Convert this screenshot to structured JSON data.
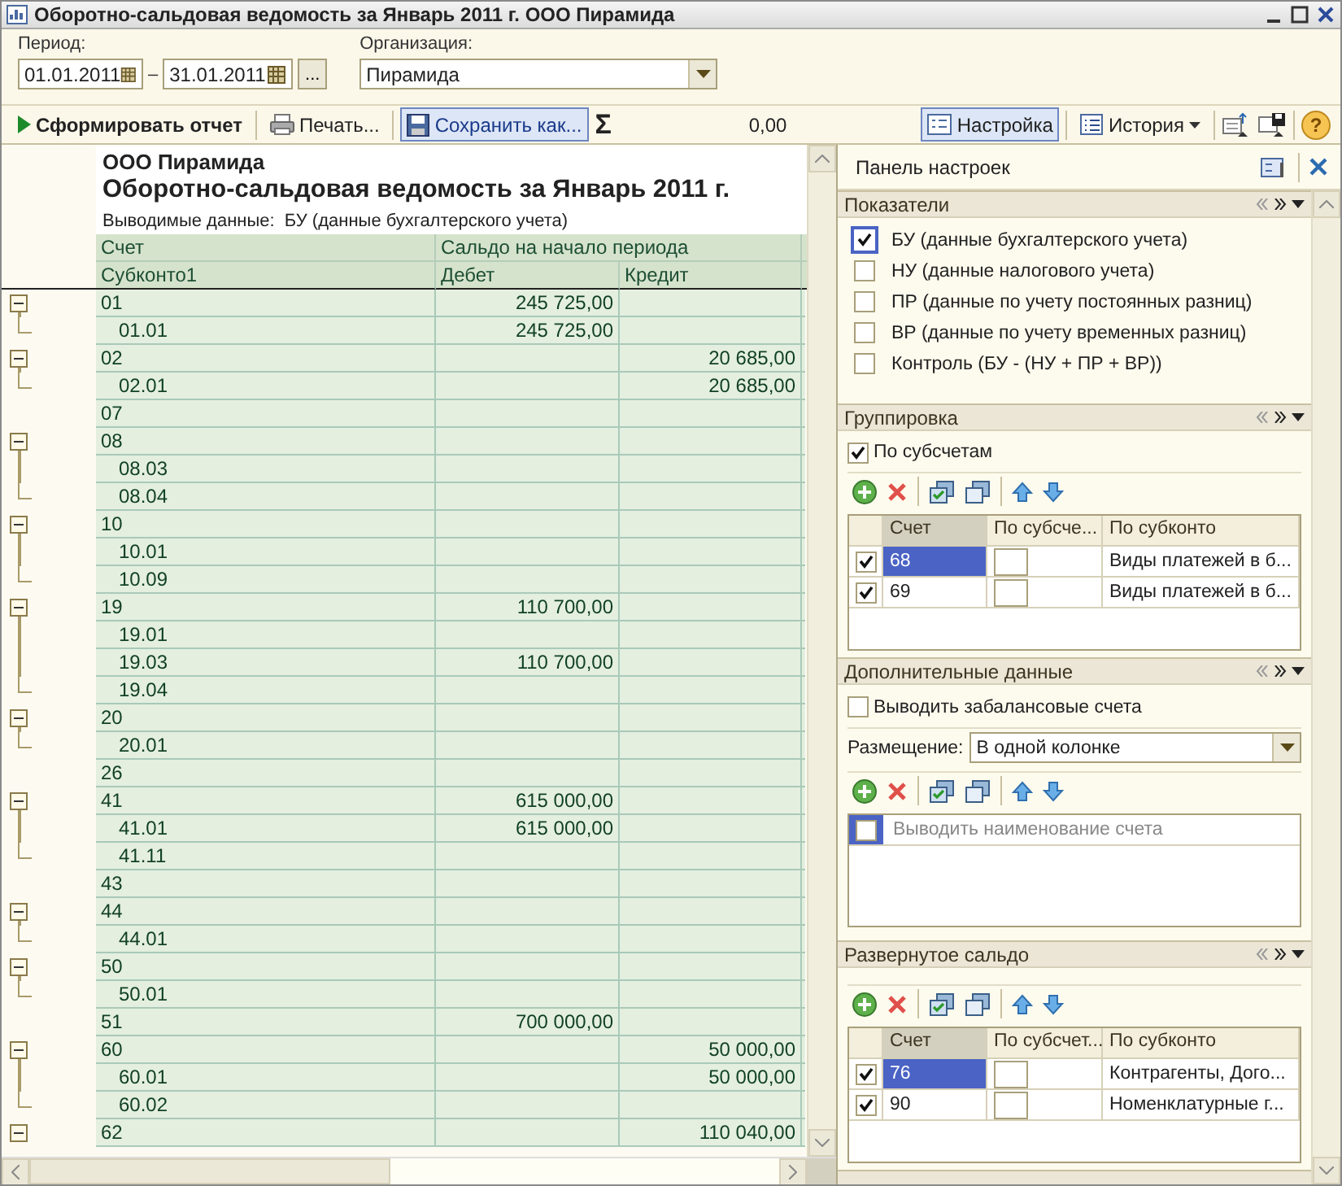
{
  "window": {
    "title": "Оборотно-сальдовая ведомость за Январь 2011 г. ООО Пирамида"
  },
  "form": {
    "period_label": "Период:",
    "date_from": "01.01.2011",
    "dash": "–",
    "date_to": "31.01.2011",
    "period_button": "...",
    "organization_label": "Организация:",
    "organization": "Пирамида"
  },
  "toolbar": {
    "generate": "Сформировать отчет",
    "print": "Печать...",
    "save": {
      "label": "Сохранить как...",
      "selected": true
    },
    "sigma": "Σ",
    "sum": "0,00",
    "settings": {
      "label": "Настройка",
      "selected": true
    },
    "history": "История",
    "help": "?"
  },
  "report": {
    "company": "ООО Пирамида",
    "title": "Оборотно-сальдовая ведомость за Январь 2011 г.",
    "output_label": "Выводимые данные:",
    "output_value": "БУ (данные бухгалтерского учета)",
    "header": {
      "account": "Счет",
      "subconto": "Субконто1",
      "balance": "Сальдо на начало периода",
      "debit": "Дебет",
      "credit": "Кредит"
    },
    "rows": [
      {
        "account": "01",
        "debit": "245 725,00",
        "expanded": true,
        "children": [
          {
            "account": "01.01",
            "debit": "245 725,00"
          }
        ]
      },
      {
        "account": "02",
        "credit": "20 685,00",
        "expanded": true,
        "children": [
          {
            "account": "02.01",
            "credit": "20 685,00"
          }
        ]
      },
      {
        "account": "07"
      },
      {
        "account": "08",
        "expanded": true,
        "children": [
          {
            "account": "08.03"
          },
          {
            "account": "08.04"
          }
        ]
      },
      {
        "account": "10",
        "expanded": true,
        "children": [
          {
            "account": "10.01"
          },
          {
            "account": "10.09"
          }
        ]
      },
      {
        "account": "19",
        "debit": "110 700,00",
        "expanded": true,
        "children": [
          {
            "account": "19.01"
          },
          {
            "account": "19.03",
            "debit": "110 700,00"
          },
          {
            "account": "19.04"
          }
        ]
      },
      {
        "account": "20",
        "expanded": true,
        "children": [
          {
            "account": "20.01"
          }
        ]
      },
      {
        "account": "26"
      },
      {
        "account": "41",
        "debit": "615 000,00",
        "expanded": true,
        "children": [
          {
            "account": "41.01",
            "debit": "615 000,00"
          },
          {
            "account": "41.11"
          }
        ]
      },
      {
        "account": "43"
      },
      {
        "account": "44",
        "expanded": true,
        "children": [
          {
            "account": "44.01"
          }
        ]
      },
      {
        "account": "50",
        "expanded": true,
        "children": [
          {
            "account": "50.01"
          }
        ]
      },
      {
        "account": "51",
        "debit": "700 000,00"
      },
      {
        "account": "60",
        "credit": "50 000,00",
        "expanded": true,
        "children": [
          {
            "account": "60.01",
            "credit": "50 000,00"
          },
          {
            "account": "60.02"
          }
        ]
      },
      {
        "account": "62",
        "credit": "110 040,00",
        "expanded": true
      }
    ]
  },
  "settings_panel": {
    "title": "Панель настроек",
    "indicators": {
      "title": "Показатели",
      "items": [
        {
          "label": "БУ (данные бухгалтерского учета)",
          "checked": true,
          "selected": true
        },
        {
          "label": "НУ (данные налогового учета)",
          "checked": false,
          "selected": false
        },
        {
          "label": "ПР (данные по учету постоянных разниц)",
          "checked": false,
          "selected": false
        },
        {
          "label": "ВР (данные по учету временных разниц)",
          "checked": false,
          "selected": false
        },
        {
          "label": "Контроль (БУ - (НУ + ПР + ВР))",
          "checked": false,
          "selected": false
        }
      ]
    },
    "grouping": {
      "title": "Группировка",
      "option": {
        "label": "По субсчетам",
        "checked": true
      },
      "columns": [
        {
          "label": "Счет",
          "selected": true
        },
        {
          "label": "По субсче...",
          "selected": false
        },
        {
          "label": "По субконто",
          "selected": false
        }
      ],
      "rows": [
        {
          "checked": true,
          "account": "68",
          "by_subaccounts": false,
          "by_subconto": "Виды платежей в б...",
          "selected": true
        },
        {
          "checked": true,
          "account": "69",
          "by_subaccounts": false,
          "by_subconto": "Виды платежей в б...",
          "selected": false
        }
      ]
    },
    "additional": {
      "title": "Дополнительные данные",
      "option": {
        "label": "Выводить забалансовые счета",
        "checked": false
      },
      "placement_label": "Размещение:",
      "placement": "В одной колонке",
      "items": [
        {
          "label": "Выводить наименование счета",
          "checked": false,
          "selected": true,
          "disabled": true
        }
      ]
    },
    "expanded_balance": {
      "title": "Развернутое сальдо",
      "columns": [
        {
          "label": "Счет",
          "selected": true
        },
        {
          "label": "По субсчет...",
          "selected": false
        },
        {
          "label": "По субконто",
          "selected": false
        }
      ],
      "rows": [
        {
          "checked": true,
          "account": "76",
          "by_subaccounts": false,
          "by_subconto": "Контрагенты, Дого...",
          "selected": true
        },
        {
          "checked": true,
          "account": "90",
          "by_subaccounts": false,
          "by_subconto": "Номенклатурные г...",
          "selected": false
        }
      ]
    }
  }
}
